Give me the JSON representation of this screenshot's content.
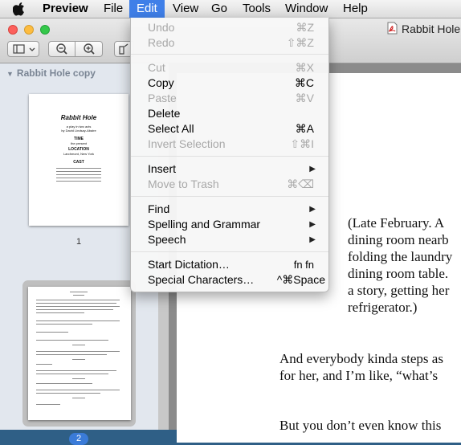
{
  "menubar": {
    "app": "Preview",
    "items": [
      "File",
      "Edit",
      "View",
      "Go",
      "Tools",
      "Window",
      "Help"
    ],
    "active": "Edit",
    "accent": "#3f7fe8"
  },
  "window": {
    "title": "Rabbit Hole",
    "traffic_lights": [
      "#fc605c",
      "#fdbc40",
      "#34c84a"
    ]
  },
  "sidebar": {
    "header": "Rabbit Hole copy",
    "thumb1": {
      "title": "Rabbit Hole",
      "lines": [
        "a play in two acts",
        "by David Lindsay-Abaire",
        "TIME",
        "the present",
        "LOCATION",
        "Larchmont, New York",
        "CAST"
      ]
    },
    "page1": "1",
    "page2": "2"
  },
  "document": {
    "lines": [
      "(Late February.  A",
      "dining room nearb",
      "folding the laundry",
      "dining room table.",
      "a story, getting her",
      "refrigerator.)",
      "And everybody kinda steps as",
      "for her, and I’m like, “what’s",
      "But you don’t even know this"
    ]
  },
  "edit_menu": {
    "items": [
      {
        "label": "Undo",
        "shortcut": "⌘Z",
        "enabled": false
      },
      {
        "label": "Redo",
        "shortcut": "⇧⌘Z",
        "enabled": false
      },
      {
        "label": "Cut",
        "shortcut": "⌘X",
        "enabled": false
      },
      {
        "label": "Copy",
        "shortcut": "⌘C",
        "enabled": true
      },
      {
        "label": "Paste",
        "shortcut": "⌘V",
        "enabled": false
      },
      {
        "label": "Delete",
        "shortcut": "",
        "enabled": true
      },
      {
        "label": "Select All",
        "shortcut": "⌘A",
        "enabled": true
      },
      {
        "label": "Invert Selection",
        "shortcut": "⇧⌘I",
        "enabled": false
      },
      {
        "label": "Insert",
        "submenu": true,
        "enabled": true
      },
      {
        "label": "Move to Trash",
        "shortcut": "⌘⌫",
        "enabled": false
      },
      {
        "label": "Find",
        "submenu": true,
        "enabled": true
      },
      {
        "label": "Spelling and Grammar",
        "submenu": true,
        "enabled": true
      },
      {
        "label": "Speech",
        "submenu": true,
        "enabled": true
      },
      {
        "label": "Start Dictation…",
        "shortcut": "fn fn",
        "enabled": true
      },
      {
        "label": "Special Characters…",
        "shortcut": "^⌘Space",
        "enabled": true
      }
    ]
  }
}
